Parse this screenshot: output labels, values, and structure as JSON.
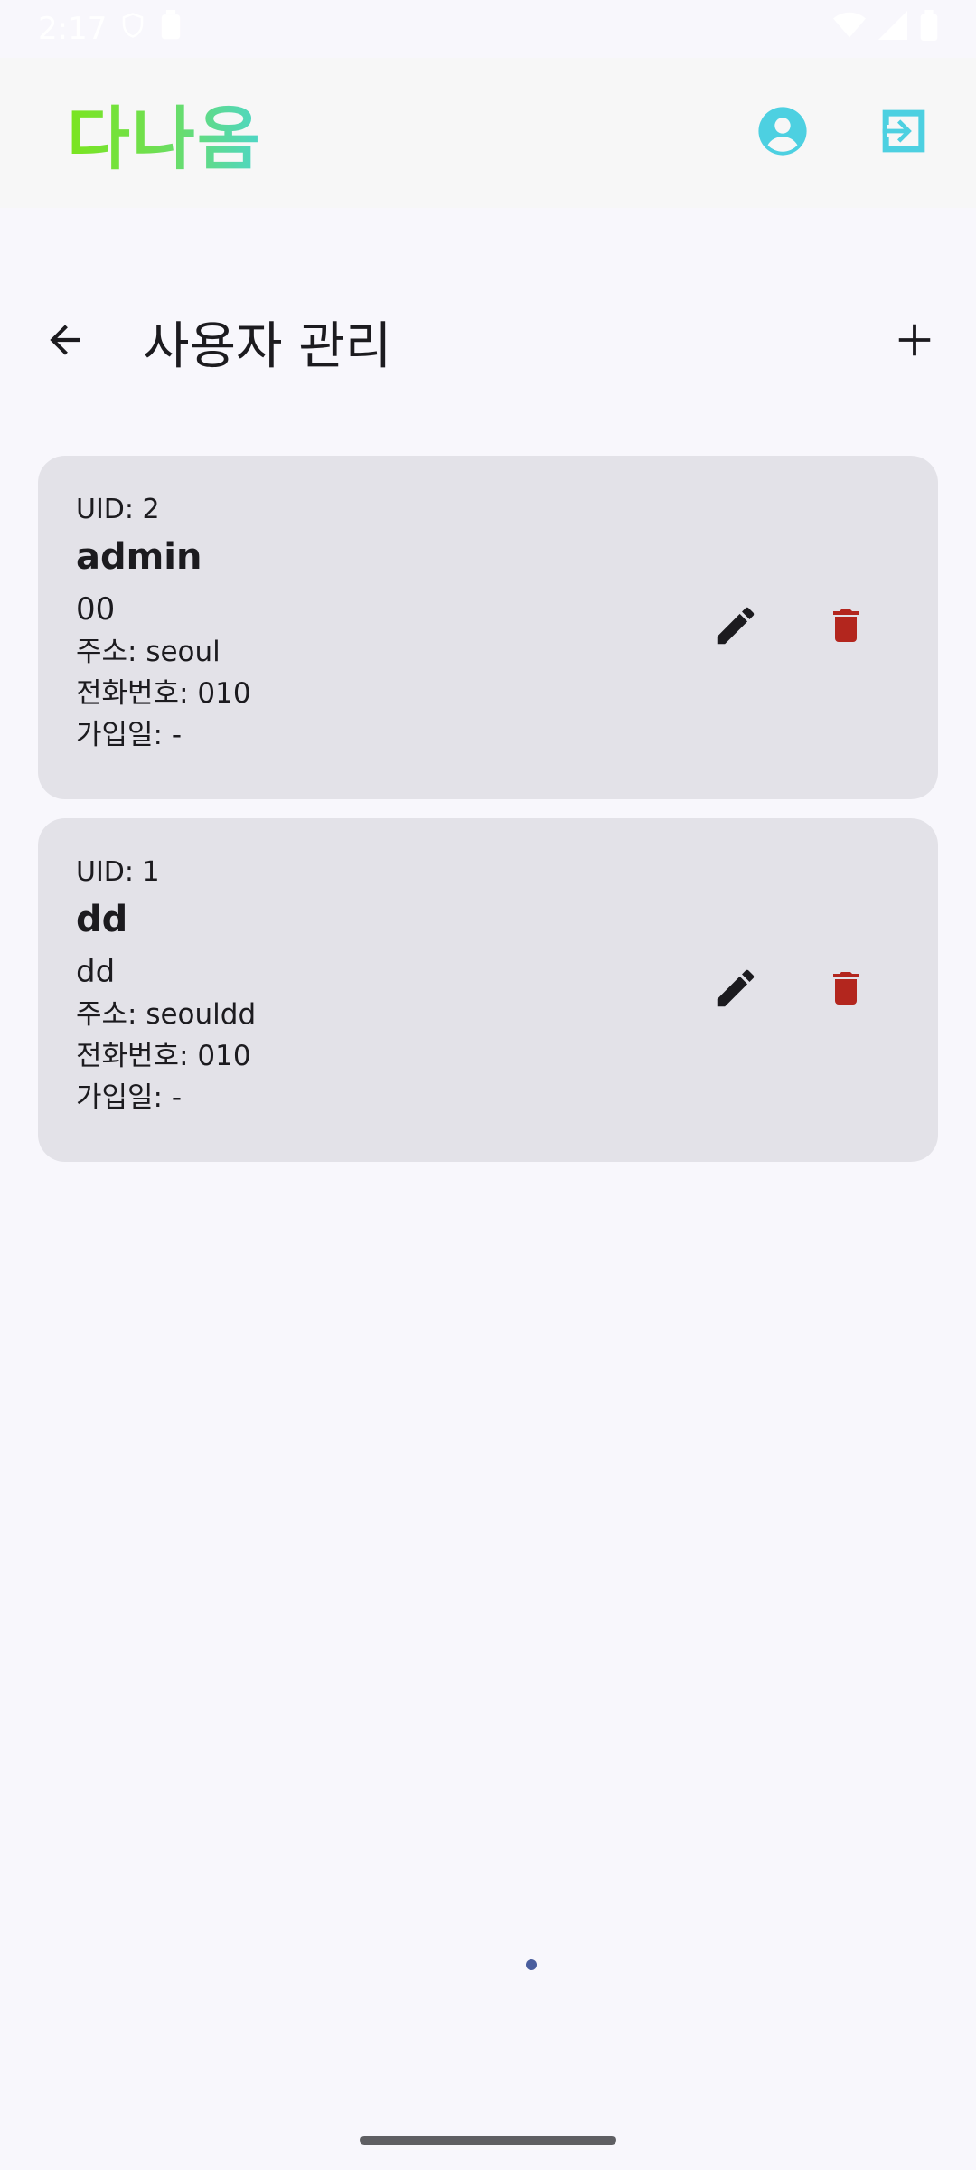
{
  "status_bar": {
    "time": "2:17"
  },
  "app_bar": {
    "brand": "다나옴"
  },
  "page": {
    "title": "사용자 관리"
  },
  "users": [
    {
      "uid": "UID: 2",
      "name": "admin",
      "sub": "00",
      "address": "주소: seoul",
      "phone": "전화번호: 010",
      "joined": "가입일: -"
    },
    {
      "uid": "UID: 1",
      "name": "dd",
      "sub": "dd",
      "address": "주소: seouldd",
      "phone": "전화번호: 010",
      "joined": "가입일: -"
    }
  ],
  "colors": {
    "accent": "#4dd0e1",
    "delete": "#b3261e",
    "brand_start": "#7be51e",
    "brand_end": "#4ed6c8"
  },
  "icons": [
    "back-arrow-icon",
    "add-icon",
    "account-circle-icon",
    "logout-icon",
    "edit-icon",
    "delete-icon"
  ]
}
